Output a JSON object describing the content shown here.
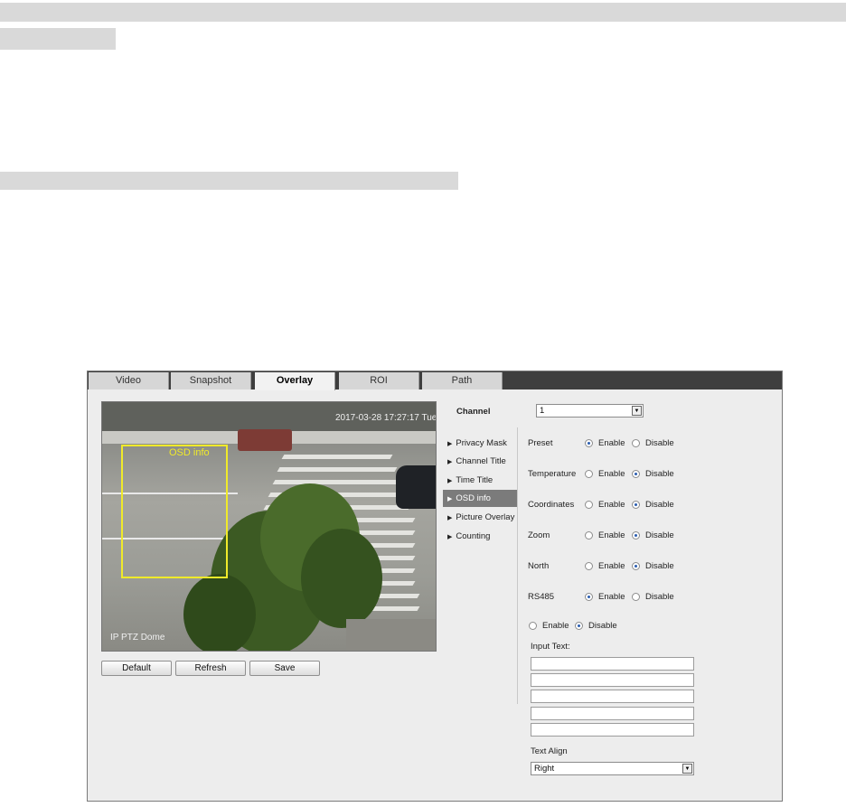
{
  "tabs": [
    {
      "label": "Video",
      "active": false
    },
    {
      "label": "Snapshot",
      "active": false
    },
    {
      "label": "Overlay",
      "active": true
    },
    {
      "label": "ROI",
      "active": false
    },
    {
      "label": "Path",
      "active": false
    }
  ],
  "preview": {
    "timestamp": "2017-03-28 17:27:17 Tue",
    "device_name": "IP PTZ Dome",
    "osd_box_label": "OSD info"
  },
  "buttons": {
    "default": "Default",
    "refresh": "Refresh",
    "save": "Save"
  },
  "channel": {
    "label": "Channel",
    "value": "1"
  },
  "menu": [
    {
      "label": "Privacy Mask",
      "active": false
    },
    {
      "label": "Channel Title",
      "active": false
    },
    {
      "label": "Time Title",
      "active": false
    },
    {
      "label": "OSD info",
      "active": true
    },
    {
      "label": "Picture Overlay",
      "active": false
    },
    {
      "label": "Counting",
      "active": false
    }
  ],
  "osd_settings": [
    {
      "label": "Preset",
      "state": "Enable"
    },
    {
      "label": "Temperature",
      "state": "Disable"
    },
    {
      "label": "Coordinates",
      "state": "Disable"
    },
    {
      "label": "Zoom",
      "state": "Disable"
    },
    {
      "label": "North",
      "state": "Disable"
    },
    {
      "label": "RS485",
      "state": "Enable"
    }
  ],
  "radio_labels": {
    "enable": "Enable",
    "disable": "Disable"
  },
  "custom_text": {
    "state": "Disable",
    "input_label": "Input Text:",
    "lines": [
      "",
      "",
      "",
      "",
      ""
    ]
  },
  "text_align": {
    "label": "Text Align",
    "value": "Right"
  },
  "colors": {
    "tab_bar": "#3e3e3e",
    "active_menu": "#7b7b7b",
    "osd_box": "#f0ea2a",
    "radio_dot": "#2a5db0"
  }
}
